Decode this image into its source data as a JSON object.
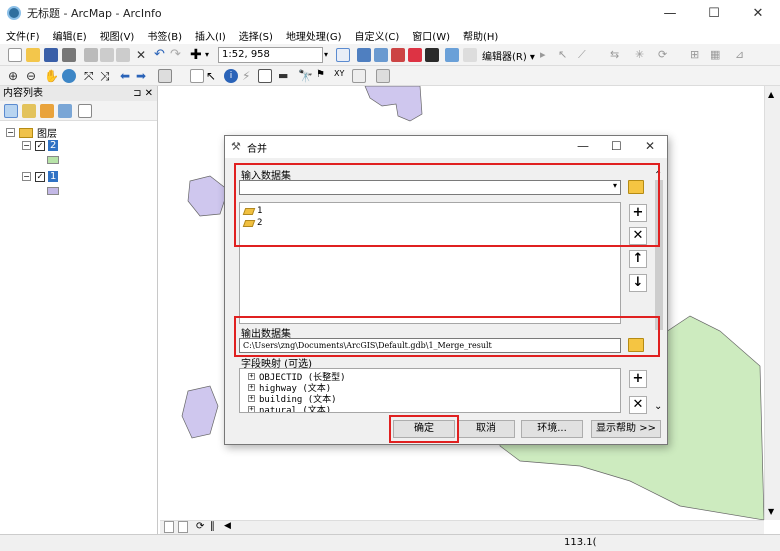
{
  "window": {
    "title": "无标题 - ArcMap - ArcInfo",
    "minimize": "—",
    "maximize": "☐",
    "close": "✕"
  },
  "menubar": {
    "items": [
      "文件(F)",
      "编辑(E)",
      "视图(V)",
      "书签(B)",
      "插入(I)",
      "选择(S)",
      "地理处理(G)",
      "自定义(C)",
      "窗口(W)",
      "帮助(H)"
    ]
  },
  "toolbar": {
    "scale": "1:52, 958",
    "editor_label": "编辑器(R) ▾"
  },
  "toc": {
    "title": "内容列表",
    "pin": "⊐ ✕",
    "layers_group": "图层",
    "layers": [
      {
        "name": "2",
        "checked": "✓",
        "color": "#b7e3a8"
      },
      {
        "name": "1",
        "checked": "✓",
        "color": "#c3b8e6"
      }
    ]
  },
  "map": {
    "green_fill": "#cdebbf",
    "purple_fill": "#cfc7ee"
  },
  "status": {
    "coords": "113.1("
  },
  "dialog": {
    "title": "合并",
    "input_label": "输入数据集",
    "input_items": [
      "1",
      "2"
    ],
    "output_label": "输出数据集",
    "output_value": "C:\\Users\\zng\\Documents\\ArcGIS\\Default.gdb\\1_Merge_result",
    "field_map_label": "字段映射 (可选)",
    "fields": [
      "OBJECTID (长整型)",
      "highway (文本)",
      "building (文本)",
      "natural (文本)"
    ],
    "buttons": {
      "ok": "确定",
      "cancel": "取消",
      "env": "环境...",
      "help": "显示帮助 >>"
    }
  }
}
